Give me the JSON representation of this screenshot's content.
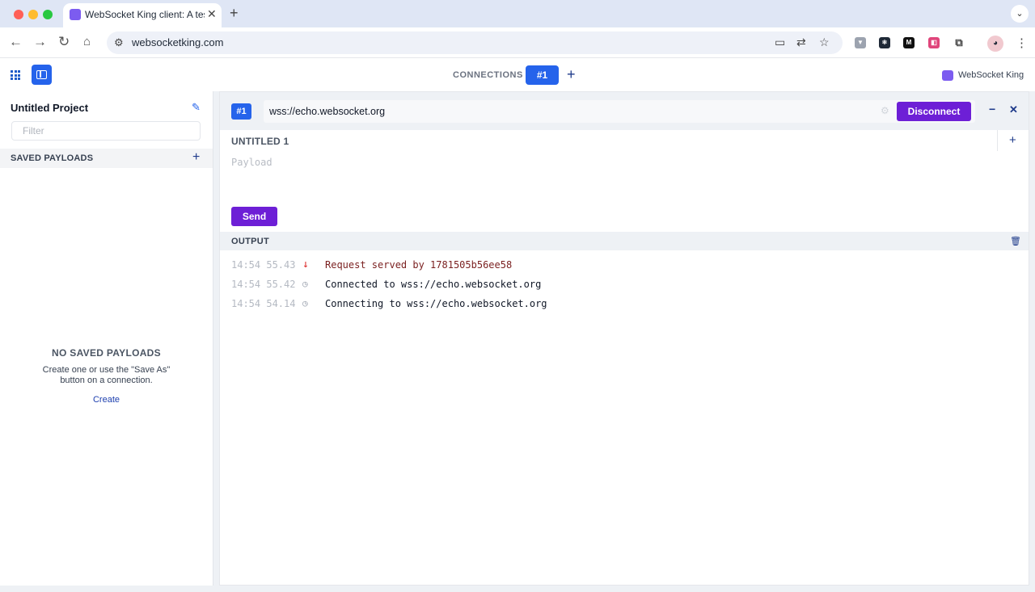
{
  "browser": {
    "tab_title": "WebSocket King client: A test",
    "url": "websocketking.com"
  },
  "app": {
    "connections_label": "CONNECTIONS",
    "active_connection": "#1",
    "brand": "WebSocket King"
  },
  "sidebar": {
    "project_title": "Untitled Project",
    "filter_placeholder": "Filter",
    "saved_payloads_label": "SAVED PAYLOADS",
    "empty_title": "NO SAVED PAYLOADS",
    "empty_description": "Create one or use the \"Save As\" button on a connection.",
    "create_link": "Create"
  },
  "connection": {
    "badge": "#1",
    "url": "wss://echo.websocket.org",
    "disconnect_label": "Disconnect",
    "message_tab": "UNTITLED 1",
    "payload_placeholder": "Payload",
    "send_label": "Send"
  },
  "output": {
    "label": "OUTPUT",
    "entries": [
      {
        "time": "14:54 55.43",
        "icon": "arrow-down-icon",
        "message": "Request served by 1781505b56ee58",
        "direction": "incoming"
      },
      {
        "time": "14:54 55.42",
        "icon": "info-circle-icon",
        "message": "Connected to wss://echo.websocket.org",
        "direction": "system"
      },
      {
        "time": "14:54 54.14",
        "icon": "info-circle-icon",
        "message": "Connecting to wss://echo.websocket.org",
        "direction": "system"
      }
    ]
  },
  "colors": {
    "accent_blue": "#2563eb",
    "action_purple": "#6d1fd6",
    "incoming_red": "#dc2626"
  }
}
